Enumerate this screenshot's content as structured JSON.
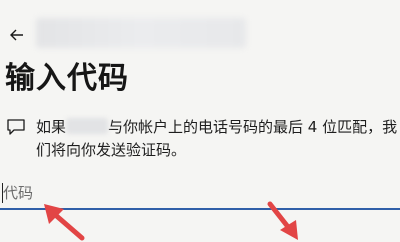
{
  "header": {
    "back_icon": "arrow-left-icon"
  },
  "page": {
    "title": "输入代码"
  },
  "message": {
    "icon": "message-icon",
    "text_before_phone": "如果",
    "text_after_phone": "与你帐户上的电话号码的最后 4 位匹配，我们将向你发送验证码。"
  },
  "code_field": {
    "placeholder": "代码",
    "value": ""
  },
  "colors": {
    "input_underline": "#2f5fa8",
    "annotation_arrow": "#e24545"
  }
}
